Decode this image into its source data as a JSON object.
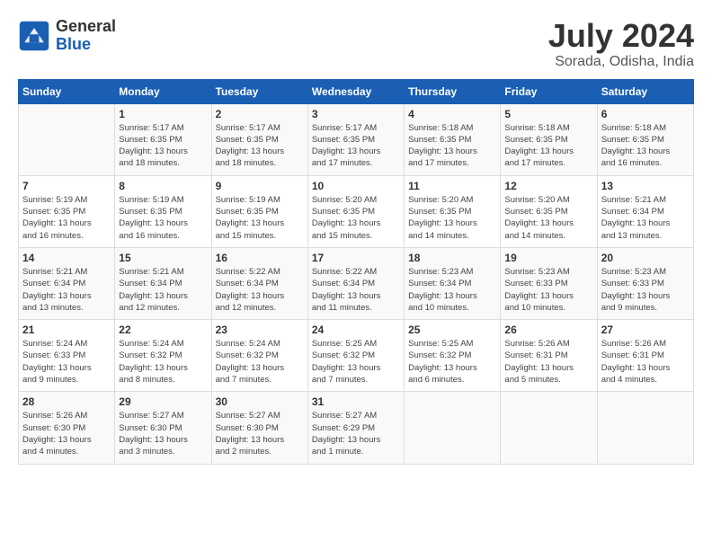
{
  "header": {
    "logo_general": "General",
    "logo_blue": "Blue",
    "month_year": "July 2024",
    "location": "Sorada, Odisha, India"
  },
  "days_of_week": [
    "Sunday",
    "Monday",
    "Tuesday",
    "Wednesday",
    "Thursday",
    "Friday",
    "Saturday"
  ],
  "weeks": [
    [
      {
        "day": "",
        "info": ""
      },
      {
        "day": "1",
        "info": "Sunrise: 5:17 AM\nSunset: 6:35 PM\nDaylight: 13 hours\nand 18 minutes."
      },
      {
        "day": "2",
        "info": "Sunrise: 5:17 AM\nSunset: 6:35 PM\nDaylight: 13 hours\nand 18 minutes."
      },
      {
        "day": "3",
        "info": "Sunrise: 5:17 AM\nSunset: 6:35 PM\nDaylight: 13 hours\nand 17 minutes."
      },
      {
        "day": "4",
        "info": "Sunrise: 5:18 AM\nSunset: 6:35 PM\nDaylight: 13 hours\nand 17 minutes."
      },
      {
        "day": "5",
        "info": "Sunrise: 5:18 AM\nSunset: 6:35 PM\nDaylight: 13 hours\nand 17 minutes."
      },
      {
        "day": "6",
        "info": "Sunrise: 5:18 AM\nSunset: 6:35 PM\nDaylight: 13 hours\nand 16 minutes."
      }
    ],
    [
      {
        "day": "7",
        "info": "Sunrise: 5:19 AM\nSunset: 6:35 PM\nDaylight: 13 hours\nand 16 minutes."
      },
      {
        "day": "8",
        "info": "Sunrise: 5:19 AM\nSunset: 6:35 PM\nDaylight: 13 hours\nand 16 minutes."
      },
      {
        "day": "9",
        "info": "Sunrise: 5:19 AM\nSunset: 6:35 PM\nDaylight: 13 hours\nand 15 minutes."
      },
      {
        "day": "10",
        "info": "Sunrise: 5:20 AM\nSunset: 6:35 PM\nDaylight: 13 hours\nand 15 minutes."
      },
      {
        "day": "11",
        "info": "Sunrise: 5:20 AM\nSunset: 6:35 PM\nDaylight: 13 hours\nand 14 minutes."
      },
      {
        "day": "12",
        "info": "Sunrise: 5:20 AM\nSunset: 6:35 PM\nDaylight: 13 hours\nand 14 minutes."
      },
      {
        "day": "13",
        "info": "Sunrise: 5:21 AM\nSunset: 6:34 PM\nDaylight: 13 hours\nand 13 minutes."
      }
    ],
    [
      {
        "day": "14",
        "info": "Sunrise: 5:21 AM\nSunset: 6:34 PM\nDaylight: 13 hours\nand 13 minutes."
      },
      {
        "day": "15",
        "info": "Sunrise: 5:21 AM\nSunset: 6:34 PM\nDaylight: 13 hours\nand 12 minutes."
      },
      {
        "day": "16",
        "info": "Sunrise: 5:22 AM\nSunset: 6:34 PM\nDaylight: 13 hours\nand 12 minutes."
      },
      {
        "day": "17",
        "info": "Sunrise: 5:22 AM\nSunset: 6:34 PM\nDaylight: 13 hours\nand 11 minutes."
      },
      {
        "day": "18",
        "info": "Sunrise: 5:23 AM\nSunset: 6:34 PM\nDaylight: 13 hours\nand 10 minutes."
      },
      {
        "day": "19",
        "info": "Sunrise: 5:23 AM\nSunset: 6:33 PM\nDaylight: 13 hours\nand 10 minutes."
      },
      {
        "day": "20",
        "info": "Sunrise: 5:23 AM\nSunset: 6:33 PM\nDaylight: 13 hours\nand 9 minutes."
      }
    ],
    [
      {
        "day": "21",
        "info": "Sunrise: 5:24 AM\nSunset: 6:33 PM\nDaylight: 13 hours\nand 9 minutes."
      },
      {
        "day": "22",
        "info": "Sunrise: 5:24 AM\nSunset: 6:32 PM\nDaylight: 13 hours\nand 8 minutes."
      },
      {
        "day": "23",
        "info": "Sunrise: 5:24 AM\nSunset: 6:32 PM\nDaylight: 13 hours\nand 7 minutes."
      },
      {
        "day": "24",
        "info": "Sunrise: 5:25 AM\nSunset: 6:32 PM\nDaylight: 13 hours\nand 7 minutes."
      },
      {
        "day": "25",
        "info": "Sunrise: 5:25 AM\nSunset: 6:32 PM\nDaylight: 13 hours\nand 6 minutes."
      },
      {
        "day": "26",
        "info": "Sunrise: 5:26 AM\nSunset: 6:31 PM\nDaylight: 13 hours\nand 5 minutes."
      },
      {
        "day": "27",
        "info": "Sunrise: 5:26 AM\nSunset: 6:31 PM\nDaylight: 13 hours\nand 4 minutes."
      }
    ],
    [
      {
        "day": "28",
        "info": "Sunrise: 5:26 AM\nSunset: 6:30 PM\nDaylight: 13 hours\nand 4 minutes."
      },
      {
        "day": "29",
        "info": "Sunrise: 5:27 AM\nSunset: 6:30 PM\nDaylight: 13 hours\nand 3 minutes."
      },
      {
        "day": "30",
        "info": "Sunrise: 5:27 AM\nSunset: 6:30 PM\nDaylight: 13 hours\nand 2 minutes."
      },
      {
        "day": "31",
        "info": "Sunrise: 5:27 AM\nSunset: 6:29 PM\nDaylight: 13 hours\nand 1 minute."
      },
      {
        "day": "",
        "info": ""
      },
      {
        "day": "",
        "info": ""
      },
      {
        "day": "",
        "info": ""
      }
    ]
  ]
}
